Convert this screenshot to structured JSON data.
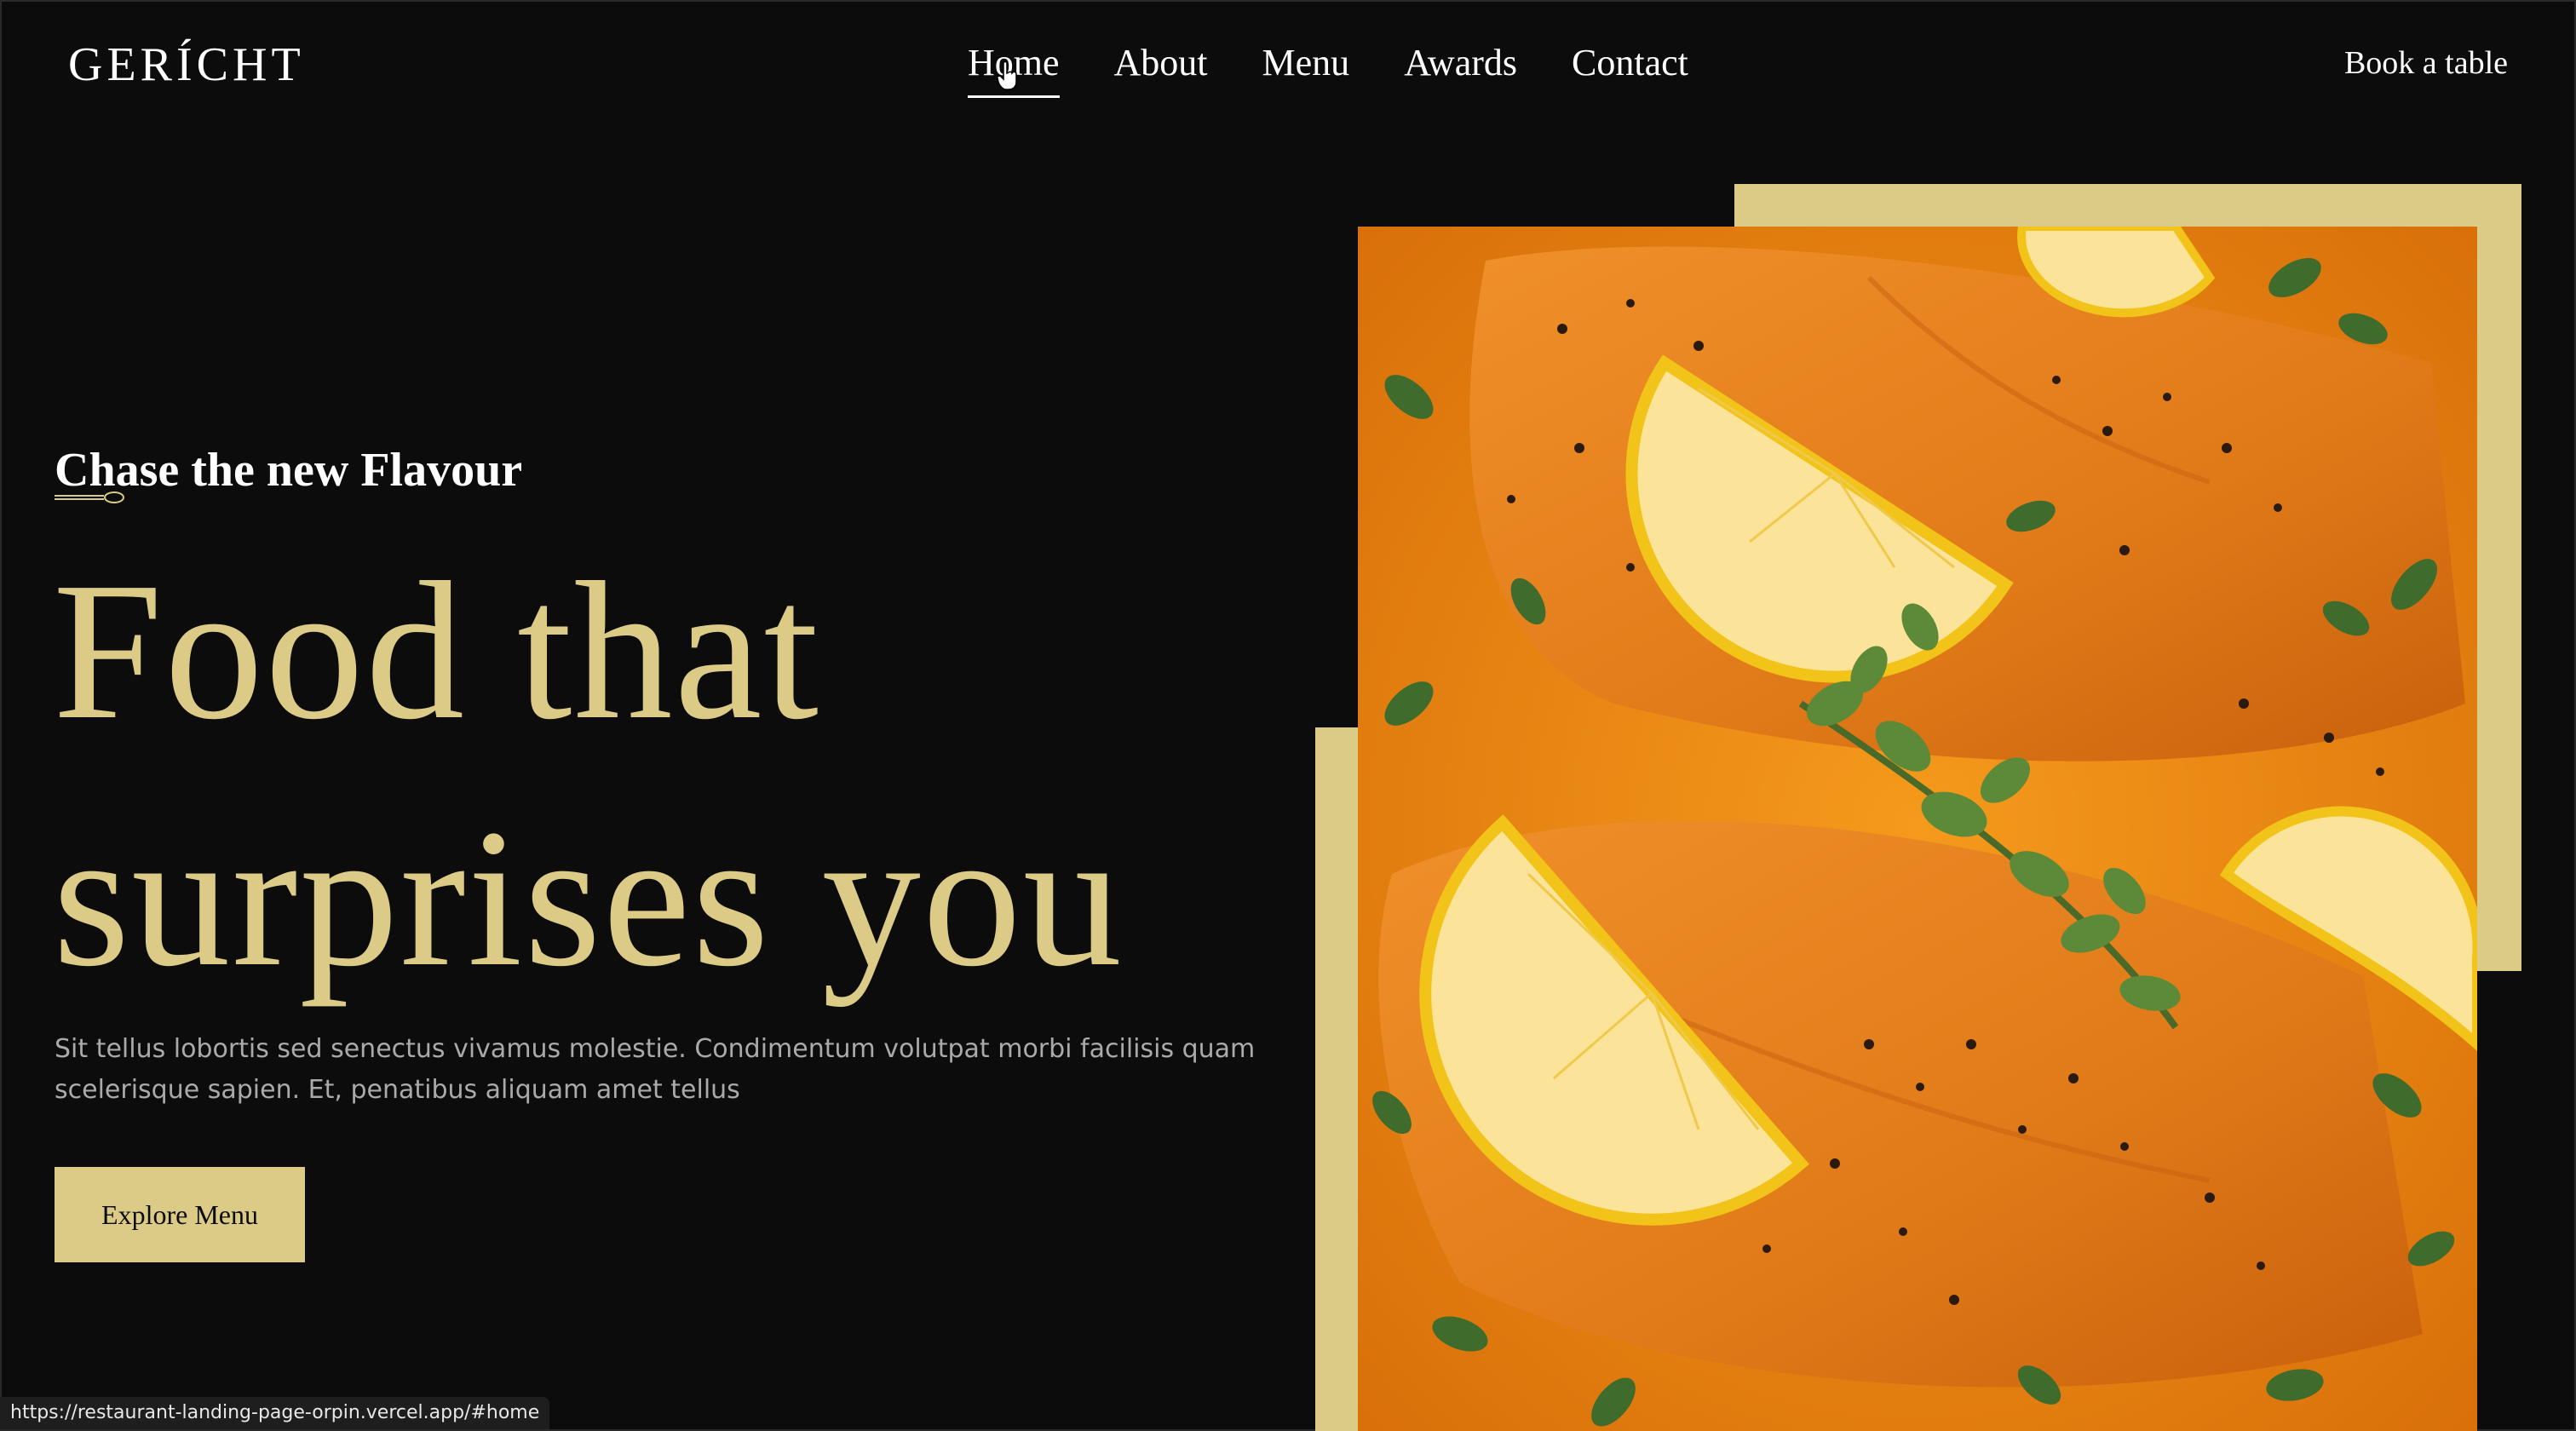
{
  "brand": {
    "logo": "GERÍCHT"
  },
  "nav": {
    "items": [
      {
        "label": "Home",
        "active": true
      },
      {
        "label": "About"
      },
      {
        "label": "Menu"
      },
      {
        "label": "Awards"
      },
      {
        "label": "Contact"
      }
    ],
    "book_label": "Book a table"
  },
  "hero": {
    "subtitle": "Chase the new Flavour",
    "headline_line1": "Food that",
    "headline_line2": "surprises you",
    "description": "Sit tellus lobortis sed senectus vivamus molestie. Condimentum volutpat morbi facilisis quam scelerisque sapien. Et, penatibus aliquam amet tellus",
    "cta_label": "Explore Menu"
  },
  "status_bar": {
    "url": "https://restaurant-landing-page-orpin.vercel.app/#home"
  },
  "colors": {
    "accent_gold": "#dcca87",
    "background": "#0c0c0c",
    "text_muted": "#aaaaaa"
  },
  "icons": {
    "cursor": "hand-pointer-icon",
    "divider": "spoon-icon"
  }
}
